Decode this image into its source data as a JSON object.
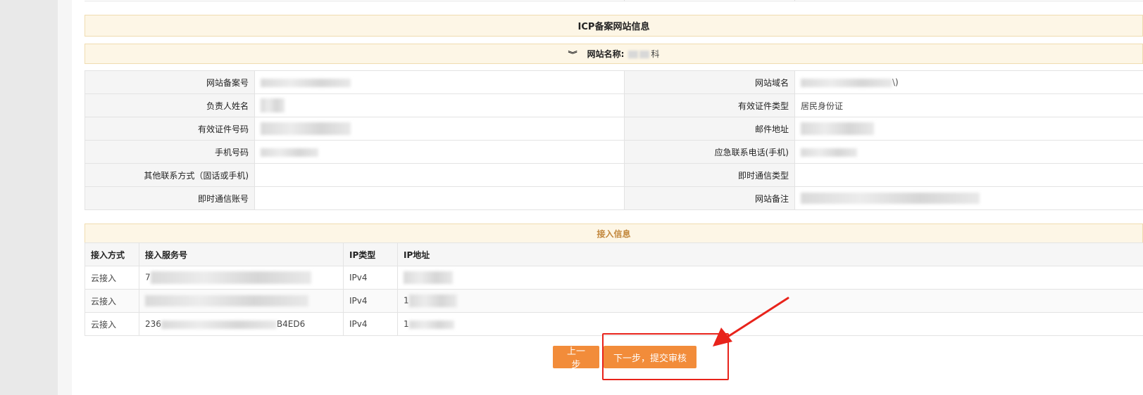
{
  "section_title": "ICP备案网站信息",
  "site": {
    "name_label": "网站名称:",
    "name_value_suffix": "科"
  },
  "site_info": {
    "rows": [
      {
        "left_label": "网站备案号",
        "left_value": "",
        "right_label": "网站域名",
        "right_value": "\\)"
      },
      {
        "left_label": "负责人姓名",
        "left_value": "",
        "right_label": "有效证件类型",
        "right_value": "居民身份证"
      },
      {
        "left_label": "有效证件号码",
        "left_value": "",
        "right_label": "邮件地址",
        "right_value": ""
      },
      {
        "left_label": "手机号码",
        "left_value": "",
        "right_label": "应急联系电话(手机)",
        "right_value": ""
      },
      {
        "left_label": "其他联系方式（固话或手机)",
        "left_value": "",
        "right_label": "即时通信类型",
        "right_value": ""
      },
      {
        "left_label": "即时通信账号",
        "left_value": "",
        "right_label": "网站备注",
        "right_value": ""
      }
    ]
  },
  "access": {
    "title": "接入信息",
    "headers": [
      "接入方式",
      "接入服务号",
      "IP类型",
      "IP地址"
    ],
    "rows": [
      {
        "method": "云接入",
        "service_no_prefix": "7",
        "service_no_suffix": "",
        "ip_type": "IPv4",
        "ip_prefix": ""
      },
      {
        "method": "云接入",
        "service_no_prefix": "",
        "service_no_suffix": "",
        "ip_type": "IPv4",
        "ip_prefix": "1"
      },
      {
        "method": "云接入",
        "service_no_prefix": "236",
        "service_no_suffix": "B4ED6",
        "ip_type": "IPv4",
        "ip_prefix": "1"
      }
    ]
  },
  "buttons": {
    "prev": "上一步",
    "next": "下一步，提交审核"
  },
  "colors": {
    "button": "#f28c3a",
    "band_bg": "#fdf6e6",
    "annotation": "#e8231b",
    "access_title": "#c2873c"
  }
}
